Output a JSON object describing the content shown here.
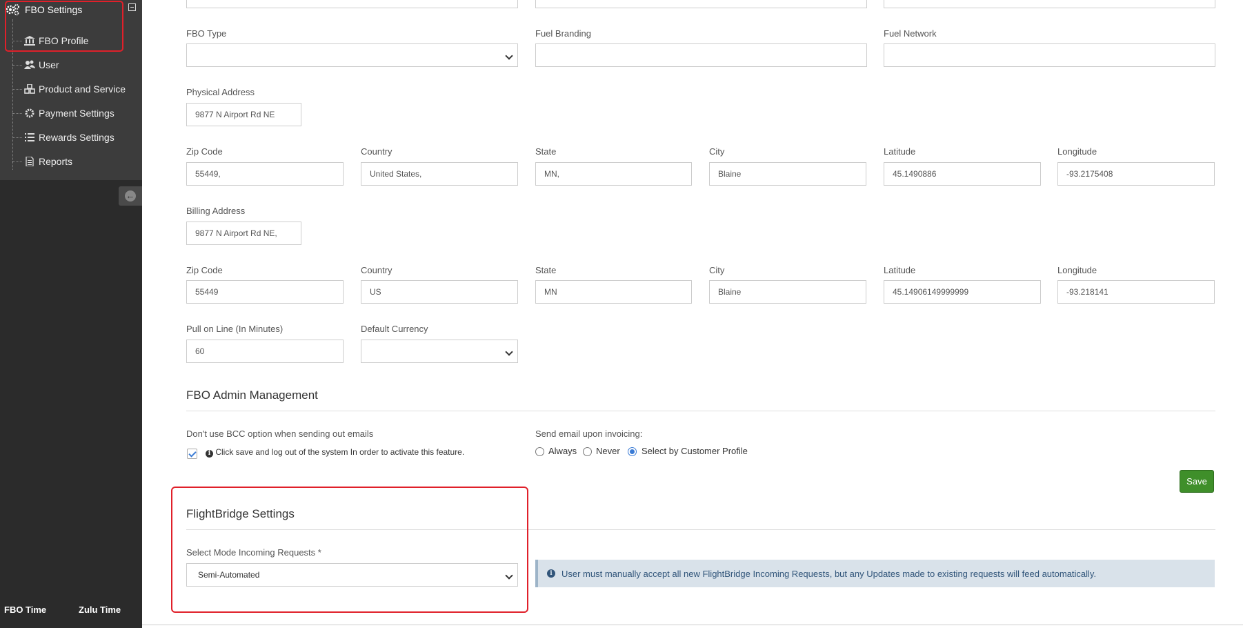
{
  "sidebar": {
    "header": "FBO Settings",
    "items": [
      {
        "label": "FBO Profile",
        "icon": "bank-icon"
      },
      {
        "label": "User",
        "icon": "users-icon"
      },
      {
        "label": "Product and Service",
        "icon": "cubes-icon"
      },
      {
        "label": "Payment Settings",
        "icon": "gear-icon"
      },
      {
        "label": "Rewards Settings",
        "icon": "list-icon"
      },
      {
        "label": "Reports",
        "icon": "file-icon"
      }
    ],
    "fbo_time_label": "FBO Time",
    "zulu_time_label": "Zulu Time"
  },
  "form": {
    "fbo_type": {
      "label": "FBO Type",
      "value": ""
    },
    "fuel_branding": {
      "label": "Fuel Branding",
      "value": ""
    },
    "fuel_network": {
      "label": "Fuel Network",
      "value": ""
    },
    "physical": {
      "address_label": "Physical Address",
      "address": "9877 N Airport Rd NE",
      "zip_label": "Zip Code",
      "zip": "55449,",
      "country_label": "Country",
      "country": "United States,",
      "state_label": "State",
      "state": "MN,",
      "city_label": "City",
      "city": "Blaine",
      "lat_label": "Latitude",
      "lat": "45.1490886",
      "lng_label": "Longitude",
      "lng": "-93.2175408"
    },
    "billing": {
      "address_label": "Billing Address",
      "address": "9877 N Airport Rd NE,",
      "zip_label": "Zip Code",
      "zip": "55449",
      "country_label": "Country",
      "country": "US",
      "state_label": "State",
      "state": "MN",
      "city_label": "City",
      "city": "Blaine",
      "lat_label": "Latitude",
      "lat": "45.14906149999999",
      "lng_label": "Longitude",
      "lng": "-93.218141"
    },
    "pull_on_line": {
      "label": "Pull on Line (In Minutes)",
      "value": "60"
    },
    "default_currency": {
      "label": "Default Currency",
      "value": ""
    }
  },
  "admin": {
    "title": "FBO Admin Management",
    "bcc_label": "Don't use BCC option when sending out emails",
    "bcc_checked": true,
    "bcc_note": "Click save and log out of the system In order to activate this feature.",
    "send_email_label": "Send email upon invoicing:",
    "options": [
      "Always",
      "Never",
      "Select by Customer Profile"
    ],
    "selected": "Select by Customer Profile",
    "save_label": "Save"
  },
  "flightbridge": {
    "title": "FlightBridge Settings",
    "mode_label": "Select Mode Incoming Requests *",
    "mode_value": "Semi-Automated",
    "info": "User must manually accept all new FlightBridge Incoming Requests, but any Updates made to existing requests will feed automatically."
  },
  "colors": {
    "sidebar_bg": "#2b2b2b",
    "menu_bg": "#3c3c3c",
    "save_green": "#3f8f2a",
    "highlight_red": "#e0202a",
    "alert_bg": "#d9e2ea"
  }
}
